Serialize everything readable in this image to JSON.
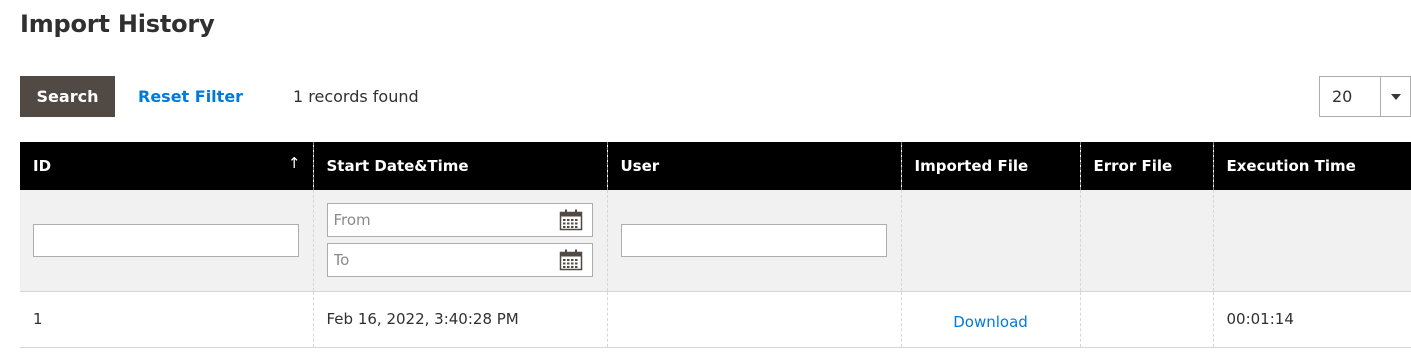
{
  "page": {
    "title": "Import History"
  },
  "toolbar": {
    "search_label": "Search",
    "reset_filter_label": "Reset Filter",
    "records_found": "1 records found",
    "per_page_value": "20"
  },
  "grid": {
    "columns": [
      {
        "label": "ID",
        "sorted": "ascending",
        "sort_glyph": "↑"
      },
      {
        "label": "Start Date&Time"
      },
      {
        "label": "User"
      },
      {
        "label": "Imported File"
      },
      {
        "label": "Error File"
      },
      {
        "label": "Execution Time"
      }
    ],
    "filters": {
      "id_value": "",
      "date_from_placeholder": "From",
      "date_to_placeholder": "To",
      "user_value": ""
    },
    "rows": [
      {
        "id": "1",
        "start_datetime": "Feb 16, 2022, 3:40:28 PM",
        "user": "",
        "imported_file": "Download",
        "error_file": "",
        "execution_time": "00:01:14"
      }
    ]
  },
  "colors": {
    "search_button_bg": "#514943",
    "link": "#007bdb",
    "header_bg": "#000000",
    "filter_row_bg": "#f1f1f1"
  },
  "icons": {
    "sort": "sort-ascending-arrow-icon",
    "calendar": "calendar-icon",
    "dropdown": "chevron-down-icon"
  }
}
